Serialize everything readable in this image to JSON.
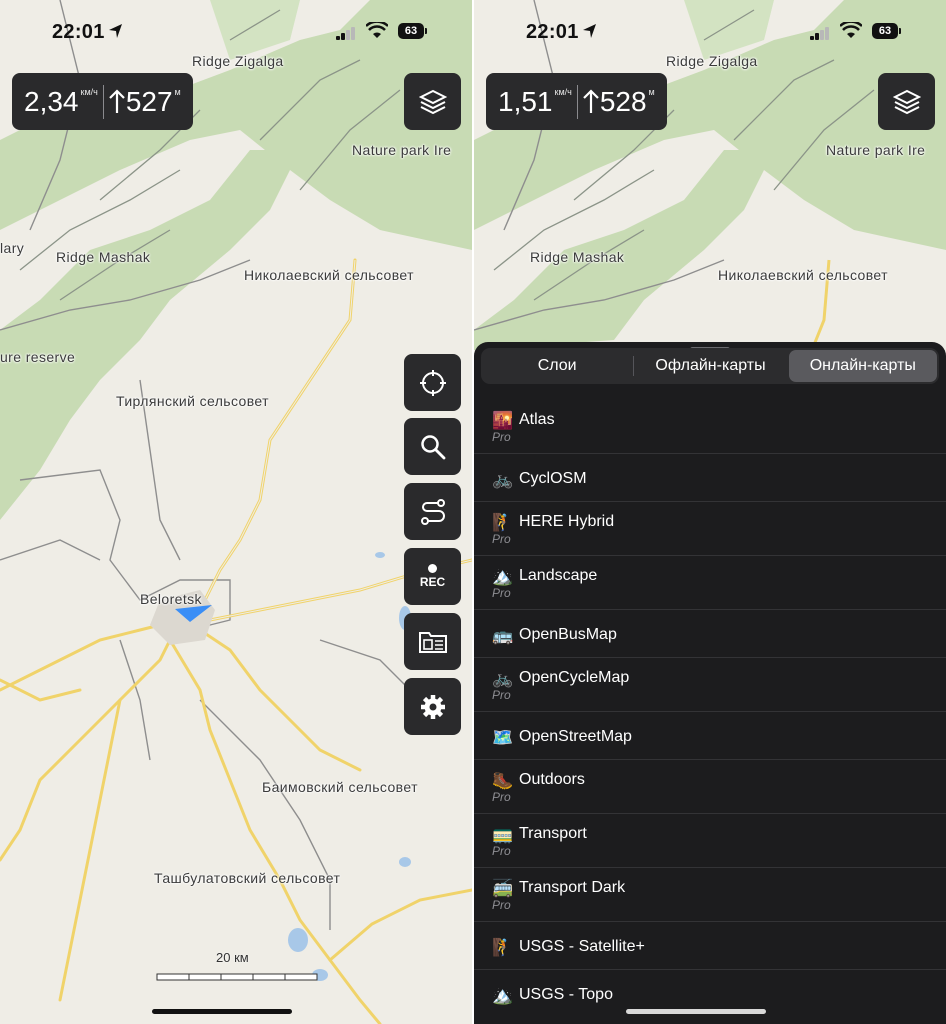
{
  "left": {
    "status": {
      "time": "22:01",
      "battery": "63"
    },
    "speed": {
      "value": "2,34",
      "unit": "км/ч",
      "altitude": "527",
      "altitude_unit": "м"
    },
    "map_labels": [
      "Ridge Zigalga",
      "Nature park Ire",
      "lary",
      "Ridge Mashak",
      "Николаевский сельсовет",
      "ure reserve",
      "Тирлянский сельсовет",
      "Beloretsk",
      "Баимовский сельсовет",
      "Ташбулатовский сельсовет"
    ],
    "scale": "20 км",
    "side_buttons": [
      {
        "icon": "locate-icon"
      },
      {
        "icon": "search-icon"
      },
      {
        "icon": "route-icon"
      },
      {
        "icon": "rec-icon",
        "label": "REC"
      },
      {
        "icon": "folder-icon"
      },
      {
        "icon": "gear-icon"
      }
    ]
  },
  "right": {
    "status": {
      "time": "22:01",
      "battery": "63"
    },
    "speed": {
      "value": "1,51",
      "unit": "км/ч",
      "altitude": "528",
      "altitude_unit": "м"
    },
    "map_labels": [
      "Ridge Zigalga",
      "Nature park Ire",
      "Ridge Mashak",
      "Николаевский сельсовет"
    ],
    "tabs": [
      "Слои",
      "Офлайн-карты",
      "Онлайн-карты"
    ],
    "active_tab": "Онлайн-карты",
    "pro_label": "Pro",
    "maps": [
      {
        "name": "Atlas",
        "emoji": "🌇",
        "pro": true
      },
      {
        "name": "CyclOSM",
        "emoji": "🚲",
        "pro": false
      },
      {
        "name": "HERE Hybrid",
        "emoji": "🧗",
        "pro": true
      },
      {
        "name": "Landscape",
        "emoji": "🏔️",
        "pro": true
      },
      {
        "name": "OpenBusMap",
        "emoji": "🚌",
        "pro": false
      },
      {
        "name": "OpenCycleMap",
        "emoji": "🚲",
        "pro": true
      },
      {
        "name": "OpenStreetMap",
        "emoji": "🗺️",
        "pro": false
      },
      {
        "name": "Outdoors",
        "emoji": "🥾",
        "pro": true
      },
      {
        "name": "Transport",
        "emoji": "🚃",
        "pro": true
      },
      {
        "name": "Transport Dark",
        "emoji": "🚎",
        "pro": true
      },
      {
        "name": "USGS - Satellite+",
        "emoji": "🧗",
        "pro": false
      },
      {
        "name": "USGS - Topo",
        "emoji": "🏔️",
        "pro": false
      }
    ]
  },
  "colors": {
    "map_bg": "#efede6",
    "forest": "#c8dbb4",
    "road": "#f0d36a",
    "water": "#a8c8e8",
    "boundary": "#8e8e8e",
    "panel_bg": "#1c1c1e",
    "control_bg": "#2a2a2c",
    "accent_arrow": "#3a8ef6"
  }
}
